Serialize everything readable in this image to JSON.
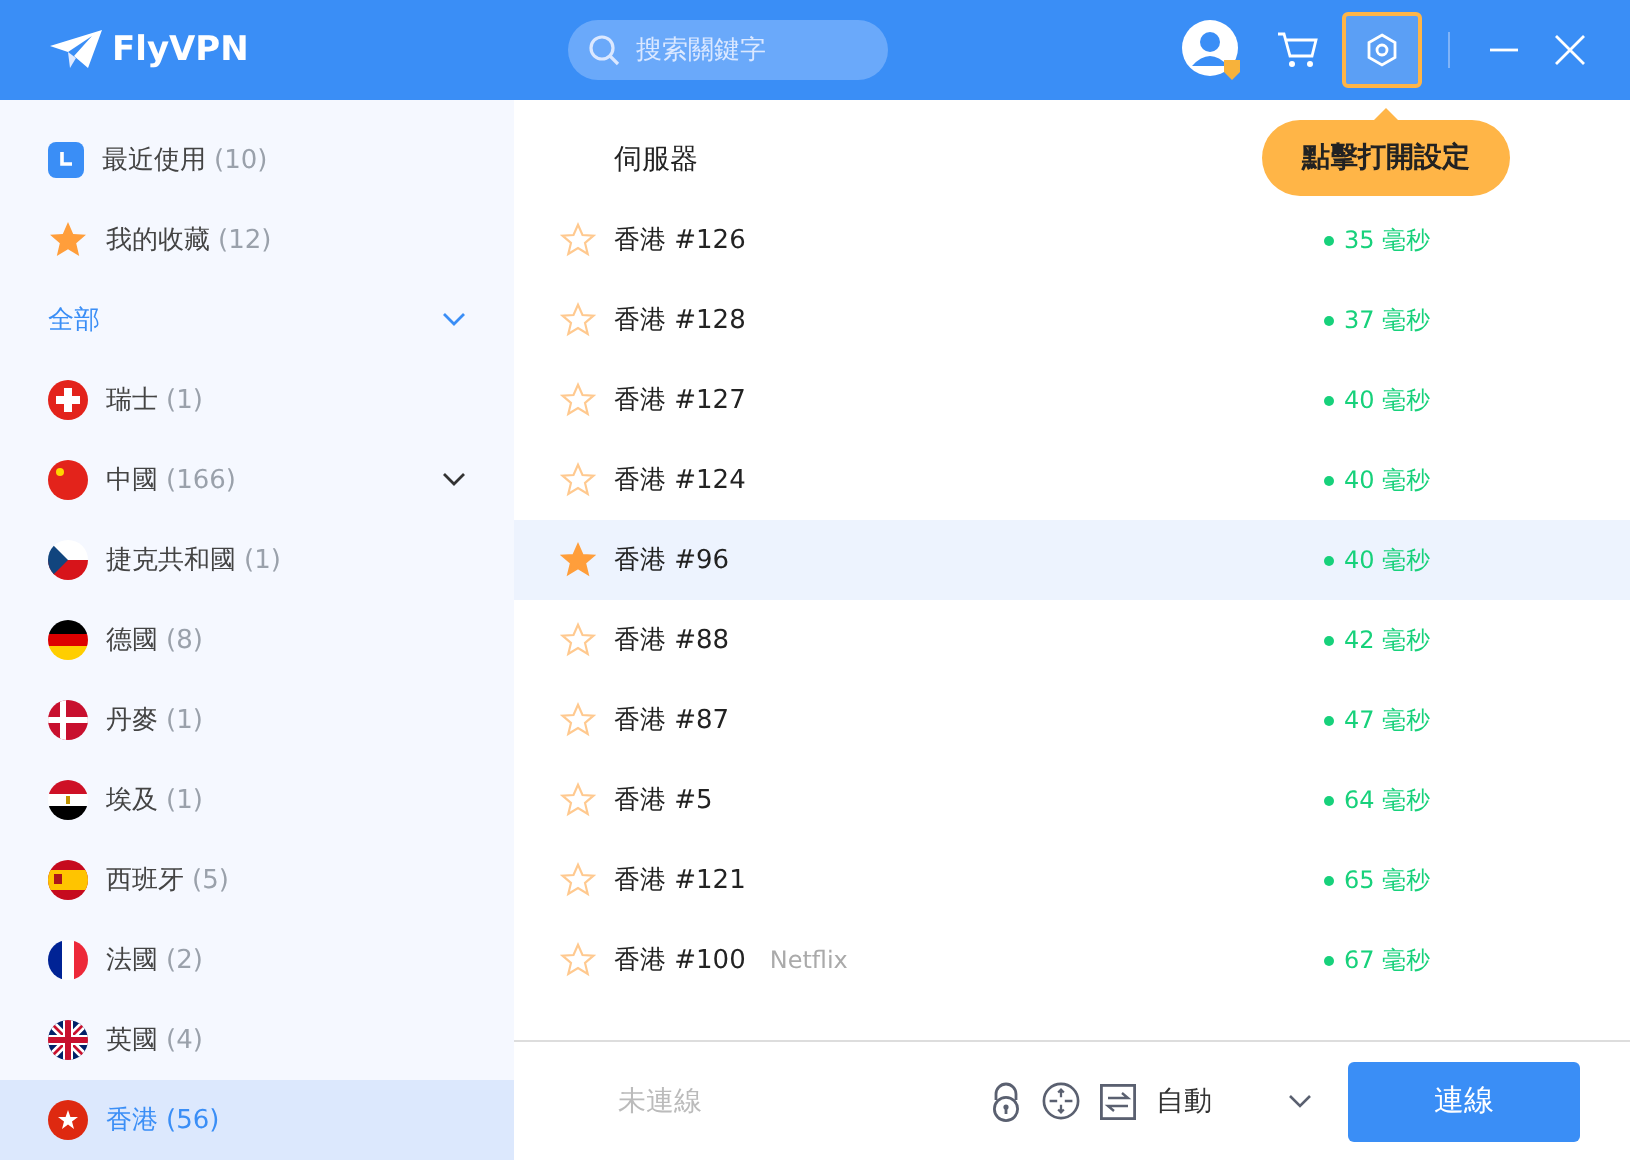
{
  "app": {
    "name": "FlyVPN"
  },
  "search": {
    "placeholder": "搜索關鍵字"
  },
  "header": {
    "settings_highlighted": true,
    "tooltip": "點擊打開設定"
  },
  "sidebar": {
    "items": [
      {
        "kind": "recent",
        "label": "最近使用",
        "count": "(10)",
        "selected": false
      },
      {
        "kind": "favorites",
        "label": "我的收藏",
        "count": "(12)",
        "selected": false
      },
      {
        "kind": "group",
        "label": "全部",
        "expanded": false,
        "selected": false
      },
      {
        "kind": "country",
        "label": "瑞士",
        "count": "(1)",
        "selected": false
      },
      {
        "kind": "country",
        "label": "中國",
        "count": "(166)",
        "expanded": false,
        "selected": false
      },
      {
        "kind": "country",
        "label": "捷克共和國",
        "count": "(1)",
        "selected": false
      },
      {
        "kind": "country",
        "label": "德國",
        "count": "(8)",
        "selected": false
      },
      {
        "kind": "country",
        "label": "丹麥",
        "count": "(1)",
        "selected": false
      },
      {
        "kind": "country",
        "label": "埃及",
        "count": "(1)",
        "selected": false
      },
      {
        "kind": "country",
        "label": "西班牙",
        "count": "(5)",
        "selected": false
      },
      {
        "kind": "country",
        "label": "法國",
        "count": "(2)",
        "selected": false
      },
      {
        "kind": "country",
        "label": "英國",
        "count": "(4)",
        "selected": false
      },
      {
        "kind": "country",
        "label": "香港",
        "count": "(56)",
        "selected": true
      }
    ]
  },
  "servers": {
    "heading": "伺服器",
    "rows": [
      {
        "name": "香港 #126",
        "latency": "35 毫秒",
        "favorite": false,
        "selected": false
      },
      {
        "name": "香港 #128",
        "latency": "37 毫秒",
        "favorite": false,
        "selected": false
      },
      {
        "name": "香港 #127",
        "latency": "40 毫秒",
        "favorite": false,
        "selected": false
      },
      {
        "name": "香港 #124",
        "latency": "40 毫秒",
        "favorite": false,
        "selected": false
      },
      {
        "name": "香港 #96",
        "latency": "40 毫秒",
        "favorite": true,
        "selected": true
      },
      {
        "name": "香港 #88",
        "latency": "42 毫秒",
        "favorite": false,
        "selected": false
      },
      {
        "name": "香港 #87",
        "latency": "47 毫秒",
        "favorite": false,
        "selected": false
      },
      {
        "name": "香港 #5",
        "latency": "64 毫秒",
        "favorite": false,
        "selected": false
      },
      {
        "name": "香港 #121",
        "latency": "65 毫秒",
        "favorite": false,
        "selected": false
      },
      {
        "name": "香港 #100",
        "tag": "Netflix",
        "latency": "67 毫秒",
        "favorite": false,
        "selected": false
      }
    ]
  },
  "footer": {
    "status": "未連線",
    "mode": "自動",
    "connect_button": "連線"
  }
}
